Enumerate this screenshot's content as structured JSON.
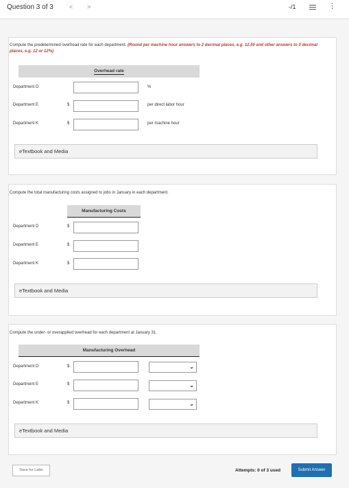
{
  "header": {
    "question_title": "Question 3 of 3",
    "prev_arrow": "<",
    "next_arrow": ">",
    "score": "-/1",
    "more_glyph": "⋮"
  },
  "part1": {
    "instruction": "Compute the predetermined overhead rate for each department.",
    "instruction_red": "(Round per machine hour answers to 2 decimal places, e.g. 12.50 and other answers to 0 decimal places, e.g. 12 or 12%)",
    "column_header": "Overhead rate",
    "rows": [
      {
        "label": "Department D",
        "dollar": "",
        "value": "",
        "unit": "%"
      },
      {
        "label": "Department E",
        "dollar": "$",
        "value": "",
        "unit": "per direct labor hour"
      },
      {
        "label": "Department K",
        "dollar": "$",
        "value": "",
        "unit": "per machine hour"
      }
    ],
    "textbook_link": "eTextbook and Media"
  },
  "part2": {
    "instruction": "Compute the total manufacturing costs assigned to jobs in January in each department.",
    "column_header": "Manufacturing Costs",
    "rows": [
      {
        "label": "Department D",
        "dollar": "$",
        "value": ""
      },
      {
        "label": "Department E",
        "dollar": "$",
        "value": ""
      },
      {
        "label": "Department K",
        "dollar": "$",
        "value": ""
      }
    ],
    "textbook_link": "eTextbook and Media"
  },
  "part3": {
    "instruction": "Compute the under- or overapplied overhead for each department at January 31.",
    "column_header": "Manufacturing Overhead",
    "rows": [
      {
        "label": "Department D",
        "dollar": "$",
        "value": "",
        "select": ""
      },
      {
        "label": "Department E",
        "dollar": "$",
        "value": "",
        "select": ""
      },
      {
        "label": "Department K",
        "dollar": "$",
        "value": "",
        "select": ""
      }
    ],
    "textbook_link": "eTextbook and Media"
  },
  "footer": {
    "save_label": "Save for Later",
    "attempts_text": "Attempts: 0 of 3 used",
    "submit_label": "Submit Answer"
  },
  "colors": {
    "accent": "#1f6fb2",
    "instruction_red": "#c0392b",
    "header_gray": "#d9d9d9"
  }
}
